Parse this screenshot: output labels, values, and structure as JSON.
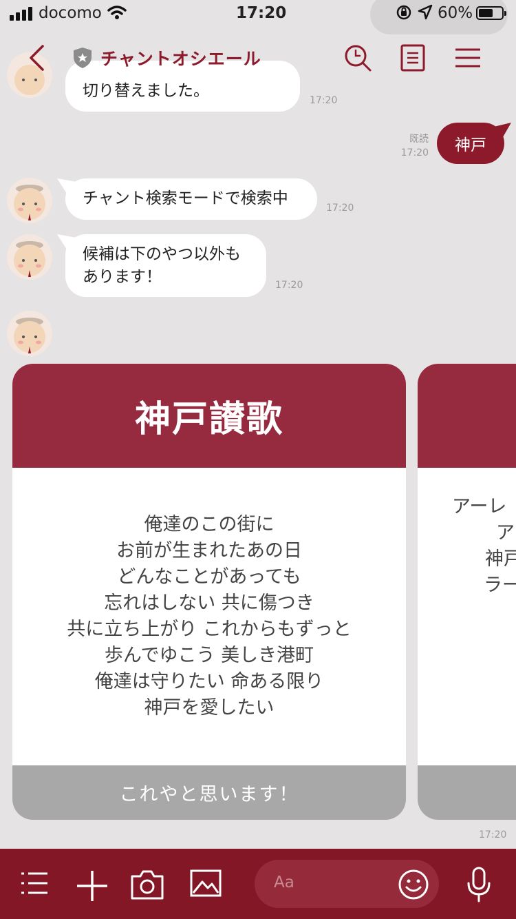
{
  "status_bar": {
    "carrier": "docomo",
    "time": "17:20",
    "battery": "60%"
  },
  "header": {
    "title": "チャントオシエール",
    "icons": [
      "back-icon",
      "shield-icon",
      "search-icon",
      "notes-icon",
      "menu-icon"
    ],
    "accent_color": "#8c1a2b"
  },
  "messages": {
    "m1": {
      "text": "切り替えました。",
      "time": "17:20"
    },
    "m2": {
      "text": "神戸",
      "read": "既読",
      "time": "17:20"
    },
    "m3": {
      "text": "チャント検索モードで検索中",
      "time": "17:20"
    },
    "m4": {
      "line1": "候補は下のやつ以外も",
      "line2": "あります！",
      "time": "17:20"
    },
    "carousel_time": "17:20"
  },
  "cards": [
    {
      "title": "神戸讃歌",
      "lyrics": [
        "俺達のこの街に",
        "お前が生まれたあの日",
        "どんなことがあっても",
        "忘れはしない 共に傷つき",
        "共に立ち上がり これからもずっと",
        "歩んでゆこう 美しき港町",
        "俺達は守りたい 命ある限り",
        "神戸を愛したい"
      ],
      "button": "これやと思います！"
    },
    {
      "lyrics_partial": [
        "アーレ",
        "ア",
        "神戸",
        "ラー"
      ]
    }
  ],
  "input": {
    "placeholder": "Aa"
  },
  "toolbar_icons": [
    "list-icon",
    "plus-icon",
    "camera-icon",
    "image-icon",
    "emoji-icon",
    "mic-icon"
  ]
}
